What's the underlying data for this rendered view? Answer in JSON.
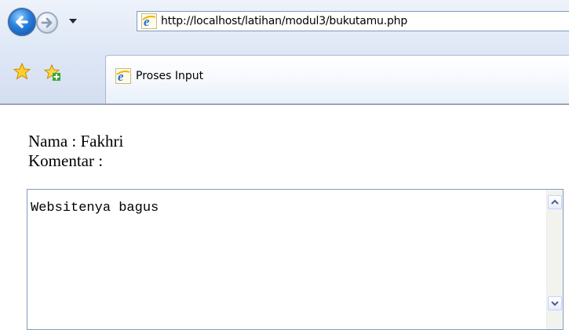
{
  "browser": {
    "address_url": "http://localhost/latihan/modul3/bukutamu.php",
    "tab_title": "Proses Input",
    "icons": {
      "back": "back-arrow-icon",
      "forward": "forward-arrow-icon",
      "history": "chevron-down-icon",
      "page": "internet-explorer-icon",
      "favorites": "favorites-star-icon",
      "add_favorite": "add-favorite-icon"
    }
  },
  "page": {
    "nama_line": "Nama : Fakhri",
    "komentar_label": "Komentar :",
    "komentar_value": "Websitenya bagus"
  },
  "colors": {
    "chrome_background": "#dfe8f6",
    "field_border": "#7f9db9",
    "back_button": "#2a7fdc"
  }
}
